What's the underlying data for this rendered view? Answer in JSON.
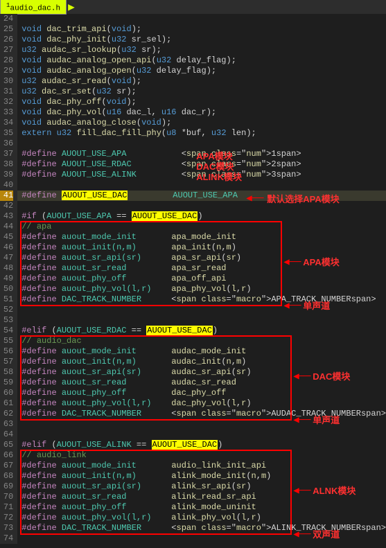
{
  "tab": {
    "filename": "audio_dac.h"
  },
  "lines": [
    {
      "n": 24,
      "t": ""
    },
    {
      "n": 25,
      "t": "void dac_trim_api(void);"
    },
    {
      "n": 26,
      "t": "void dac_phy_init(u32 sr_sel);"
    },
    {
      "n": 27,
      "t": "u32 audac_sr_lookup(u32 sr);"
    },
    {
      "n": 28,
      "t": "void audac_analog_open_api(u32 delay_flag);"
    },
    {
      "n": 29,
      "t": "void audac_analog_open(u32 delay_flag);"
    },
    {
      "n": 30,
      "t": "u32 audac_sr_read(void);"
    },
    {
      "n": 31,
      "t": "u32 dac_sr_set(u32 sr);"
    },
    {
      "n": 32,
      "t": "void dac_phy_off(void);"
    },
    {
      "n": 33,
      "t": "void dac_phy_vol(u16 dac_l, u16 dac_r);"
    },
    {
      "n": 34,
      "t": "void audac_analog_close(void);"
    },
    {
      "n": 35,
      "t": "extern u32 fill_dac_fill_phy(u8 *buf, u32 len);"
    },
    {
      "n": 36,
      "t": ""
    },
    {
      "n": 37,
      "t": "#define AUOUT_USE_APA           1"
    },
    {
      "n": 38,
      "t": "#define AUOUT_USE_RDAC          2"
    },
    {
      "n": 39,
      "t": "#define AUOUT_USE_ALINK         3"
    },
    {
      "n": 40,
      "t": ""
    },
    {
      "n": 41,
      "t": "#define AUOUT_USE_DAC         AUOUT_USE_APA",
      "hl": true
    },
    {
      "n": 42,
      "t": ""
    },
    {
      "n": 43,
      "t": "#if (AUOUT_USE_APA == AUOUT_USE_DAC)"
    },
    {
      "n": 44,
      "t": "// apa"
    },
    {
      "n": 45,
      "t": "#define auout_mode_init       apa_mode_init"
    },
    {
      "n": 46,
      "t": "#define auout_init(n,m)       apa_init(n,m)"
    },
    {
      "n": 47,
      "t": "#define auout_sr_api(sr)      apa_sr_api(sr)"
    },
    {
      "n": 48,
      "t": "#define auout_sr_read         apa_sr_read"
    },
    {
      "n": 49,
      "t": "#define auout_phy_off         apa_off_api"
    },
    {
      "n": 50,
      "t": "#define auout_phy_vol(l,r)    apa_phy_vol(l,r)"
    },
    {
      "n": 51,
      "t": "#define DAC_TRACK_NUMBER      APA_TRACK_NUMBER"
    },
    {
      "n": 52,
      "t": ""
    },
    {
      "n": 53,
      "t": ""
    },
    {
      "n": 54,
      "t": "#elif (AUOUT_USE_RDAC == AUOUT_USE_DAC)"
    },
    {
      "n": 55,
      "t": "// audio_dac"
    },
    {
      "n": 56,
      "t": "#define auout_mode_init       audac_mode_init"
    },
    {
      "n": 57,
      "t": "#define auout_init(n,m)       audac_init(n,m)"
    },
    {
      "n": 58,
      "t": "#define auout_sr_api(sr)      audac_sr_api(sr)"
    },
    {
      "n": 59,
      "t": "#define auout_sr_read         audac_sr_read"
    },
    {
      "n": 60,
      "t": "#define auout_phy_off         dac_phy_off"
    },
    {
      "n": 61,
      "t": "#define auout_phy_vol(l,r)    dac_phy_vol(l,r)"
    },
    {
      "n": 62,
      "t": "#define DAC_TRACK_NUMBER      AUDAC_TRACK_NUMBER"
    },
    {
      "n": 63,
      "t": ""
    },
    {
      "n": 64,
      "t": ""
    },
    {
      "n": 65,
      "t": "#elif (AUOUT_USE_ALINK == AUOUT_USE_DAC)"
    },
    {
      "n": 66,
      "t": "// audio_link"
    },
    {
      "n": 67,
      "t": "#define auout_mode_init       audio_link_init_api"
    },
    {
      "n": 68,
      "t": "#define auout_init(n,m)       alink_mode_init(n,m)"
    },
    {
      "n": 69,
      "t": "#define auout_sr_api(sr)      alink_sr_api(sr)"
    },
    {
      "n": 70,
      "t": "#define auout_sr_read         alink_read_sr_api"
    },
    {
      "n": 71,
      "t": "#define auout_phy_off         alink_mode_uninit"
    },
    {
      "n": 72,
      "t": "#define auout_phy_vol(l,r)    alink_phy_vol(l,r)"
    },
    {
      "n": 73,
      "t": "#define DAC_TRACK_NUMBER      ALINK_TRACK_NUMBER"
    },
    {
      "n": 74,
      "t": ""
    }
  ],
  "annotations": {
    "apa_mod": "APA模块",
    "dac_mod": "DAC模块",
    "alink_mod": "ALINK模块",
    "default_sel": "默认选择APA模块",
    "apa_block": "APA模块",
    "single_ch": "单声道",
    "dac_block": "DAC模块",
    "single_ch2": "单声道",
    "alnk_block": "ALNK模块",
    "dual_ch": "双声道"
  }
}
